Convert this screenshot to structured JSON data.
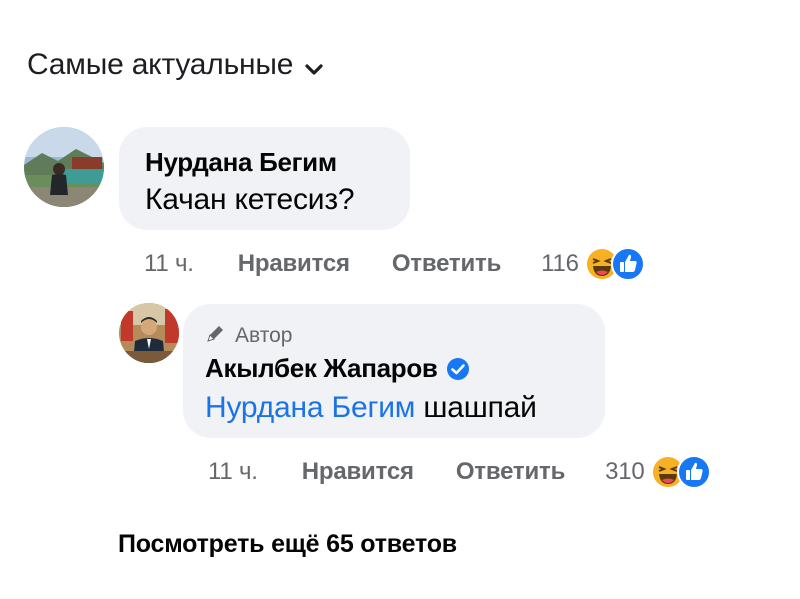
{
  "sort": {
    "label": "Самые актуальные",
    "icon": "chevron-down-icon"
  },
  "comments": [
    {
      "author": "Нурдана Бегим",
      "text": "Качан кетесиз?",
      "time": "11 ч.",
      "like_label": "Нравится",
      "reply_label": "Ответить",
      "reaction_count": "116",
      "reactions": [
        "haha-icon",
        "like-icon"
      ]
    }
  ],
  "reply": {
    "badge": "Автор",
    "badge_icon": "pen-icon",
    "author": "Акылбек Жапаров",
    "verified_icon": "verified-check-icon",
    "mention": "Нурдана Бегим",
    "text": "шашпай",
    "time": "11 ч.",
    "like_label": "Нравится",
    "reply_label": "Ответить",
    "reaction_count": "310",
    "reactions": [
      "haha-icon",
      "like-icon"
    ]
  },
  "more_replies": "Посмотреть ещё 65 ответов",
  "colors": {
    "link": "#1b74e4",
    "bubble": "#f0f2f5",
    "meta": "#65676b",
    "reaction_like": "#1877f2",
    "reaction_haha": "#f7b125"
  }
}
